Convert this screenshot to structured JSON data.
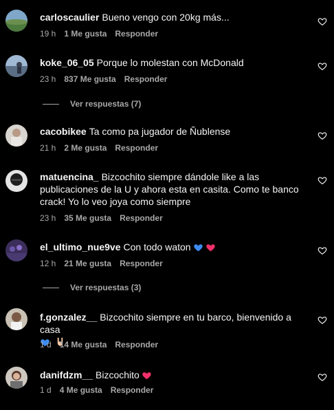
{
  "comments": [
    {
      "username": "carloscaulier",
      "text": "Bueno vengo con 20kg más...",
      "time": "19 h",
      "likes": "1 Me gusta",
      "reply": "Responder"
    },
    {
      "username": "koke_06_05",
      "text": "Porque lo molestan con McDonald",
      "time": "23 h",
      "likes": "837 Me gusta",
      "reply": "Responder"
    },
    {
      "username": "cacobikee",
      "text": "Ta como pa jugador de Ñublense",
      "time": "21 h",
      "likes": "2 Me gusta",
      "reply": "Responder"
    },
    {
      "username": "matuencina_",
      "text": "Bizcochito siempre dándole like a las publicaciones de la U y ahora esta en casita. Como te banco crack! Yo lo veo joya como siempre",
      "time": "23 h",
      "likes": "35 Me gusta",
      "reply": "Responder"
    },
    {
      "username": "el_ultimo_nue9ve",
      "text": "Con todo waton",
      "time": "12 h",
      "likes": "21 Me gusta",
      "reply": "Responder"
    },
    {
      "username": "f.gonzalez__",
      "text": "Bizcochito siempre en tu barco, bienvenido a casa",
      "time": "1 d",
      "likes": "14 Me gusta",
      "reply": "Responder"
    },
    {
      "username": "danifdzm__",
      "text": "Bizcochito",
      "time": "1 d",
      "likes": "4 Me gusta",
      "reply": "Responder"
    }
  ],
  "view_replies": [
    "Ver respuestas (7)",
    "Ver respuestas (3)"
  ],
  "colors": {
    "background": "#000000",
    "text": "#f5f5f5",
    "secondary": "#a8a8a8",
    "blue_heart": "#3d8bf2",
    "pink_heart": "#f0306a"
  }
}
